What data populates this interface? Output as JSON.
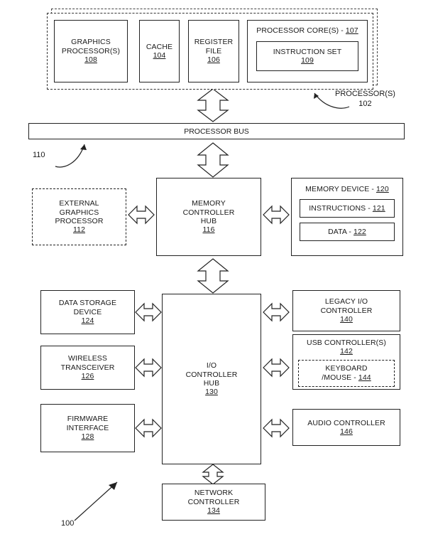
{
  "figure": {
    "ref_number": "100",
    "bus_ref": "110",
    "processor_ref_label": "PROCESSOR(S)",
    "processor_ref_number": "102"
  },
  "processor_bus": {
    "label": "PROCESSOR BUS"
  },
  "processor_block": {
    "graphics_processor": {
      "line1": "GRAPHICS",
      "line2": "PROCESSOR(S)",
      "number": "108"
    },
    "cache": {
      "line1": "CACHE",
      "number": "104"
    },
    "register_file": {
      "line1": "REGISTER",
      "line2": "FILE",
      "number": "106"
    },
    "processor_core": {
      "title": "PROCESSOR CORE(S) - ",
      "number": "107"
    },
    "instruction_set": {
      "line1": "INSTRUCTION SET",
      "number": "109"
    }
  },
  "external_graphics_processor": {
    "line1": "EXTERNAL",
    "line2": "GRAPHICS",
    "line3": "PROCESSOR",
    "number": "112"
  },
  "memory_controller_hub": {
    "line1": "MEMORY",
    "line2": "CONTROLLER",
    "line3": "HUB",
    "number": "116"
  },
  "memory_device": {
    "title": "MEMORY DEVICE - ",
    "number": "120",
    "instructions": {
      "label": "INSTRUCTIONS - ",
      "number": "121"
    },
    "data": {
      "label": "DATA - ",
      "number": "122"
    }
  },
  "io_controller_hub": {
    "line1": "I/O",
    "line2": "CONTROLLER",
    "line3": "HUB",
    "number": "130"
  },
  "left_peripherals": [
    {
      "name": "data-storage-device",
      "line1": "DATA STORAGE",
      "line2": "DEVICE",
      "number": "124"
    },
    {
      "name": "wireless-transceiver",
      "line1": "WIRELESS",
      "line2": "TRANSCEIVER",
      "number": "126"
    },
    {
      "name": "firmware-interface",
      "line1": "FIRMWARE",
      "line2": "INTERFACE",
      "number": "128"
    }
  ],
  "right_peripherals": {
    "legacy_io_controller": {
      "line1": "LEGACY I/O",
      "line2": "CONTROLLER",
      "number": "140"
    },
    "usb_controller": {
      "line1": "USB CONTROLLER(S)",
      "number": "142"
    },
    "keyboard_mouse": {
      "line1": "KEYBOARD",
      "line2": "/MOUSE - ",
      "number": "144"
    },
    "audio_controller": {
      "line1": "AUDIO CONTROLLER",
      "number": "146"
    }
  },
  "network_controller": {
    "line1": "NETWORK",
    "line2": "CONTROLLER",
    "number": "134"
  },
  "colors": {
    "line": "#222222",
    "background": "#ffffff",
    "text": "#1a1a1a"
  }
}
